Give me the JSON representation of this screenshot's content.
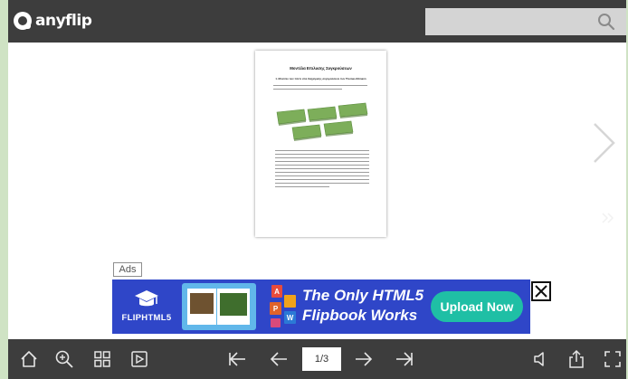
{
  "header": {
    "brand": "anyflip",
    "search": {
      "value": "",
      "placeholder": ""
    }
  },
  "document_page": {
    "heading": "Μοντέλα Επιλυσης Συγκρούσεων",
    "subheading": "1.   Μοντέλο των πέντε στιλ διαχείρισης συγκρούσεων των Thomas-Kilmann",
    "diagram_box_color": "#7dae5a",
    "diagram_box_count": 5
  },
  "ad": {
    "corner_label": "Ads",
    "brand": "FLIPHTML5",
    "headline_line1": "The Only HTML5",
    "headline_line2": "Flipbook Works",
    "cta": "Upload Now",
    "background_color": "#2f46c8",
    "cta_color": "#1fbfa5"
  },
  "toolbar": {
    "page_indicator": "1/3",
    "icons": [
      "home-icon",
      "zoom-in-icon",
      "thumbnails-icon",
      "slideshow-icon",
      "first-page-icon",
      "prev-page-icon",
      "next-page-icon",
      "last-page-icon",
      "sound-icon",
      "share-icon",
      "fullscreen-icon"
    ]
  },
  "colors": {
    "bar_background": "#3d3d3d",
    "side_background": "#cfe3c4",
    "search_background": "#d4d4d4"
  }
}
